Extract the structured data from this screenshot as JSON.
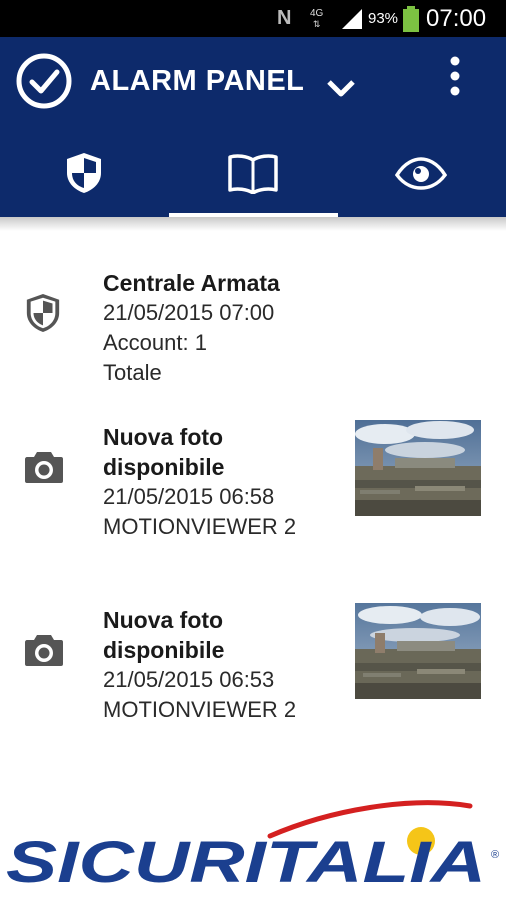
{
  "status_bar": {
    "n_label": "N",
    "network": "4G",
    "battery": "93%",
    "time": "07:00"
  },
  "appbar": {
    "title": "ALARM PANEL",
    "tabs": [
      {
        "icon": "shield-icon",
        "active": false
      },
      {
        "icon": "book-icon",
        "active": true
      },
      {
        "icon": "eye-icon",
        "active": false
      }
    ]
  },
  "events": [
    {
      "icon": "shield-icon",
      "title": "Centrale Armata",
      "lines": [
        "21/05/2015 07:00",
        "Account: 1",
        "Totale"
      ],
      "has_thumbnail": false
    },
    {
      "icon": "camera-icon",
      "title_1": "Nuova foto",
      "title_2": "disponibile",
      "lines": [
        "21/05/2015 06:58",
        "MOTIONVIEWER 2"
      ],
      "has_thumbnail": true
    },
    {
      "icon": "camera-icon",
      "title_1": "Nuova foto",
      "title_2": "disponibile",
      "lines": [
        "21/05/2015 06:53",
        "MOTIONVIEWER 2"
      ],
      "has_thumbnail": true
    }
  ],
  "logo": {
    "text": "SICURITALIA",
    "registered": "®"
  },
  "colors": {
    "appbar": "#0d2a6b",
    "logo_blue": "#1b3f8f",
    "logo_red": "#d42020",
    "logo_yellow": "#f5c518"
  }
}
